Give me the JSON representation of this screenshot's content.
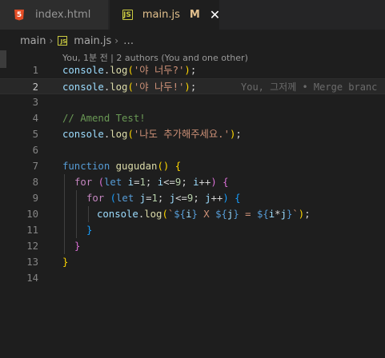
{
  "tabs": [
    {
      "label": "index.html",
      "icon": "html5-icon",
      "icon_text": "5"
    },
    {
      "label": "main.js",
      "icon": "js-file-icon",
      "icon_text": "JS",
      "badge": "M",
      "close": "✕"
    }
  ],
  "breadcrumb": {
    "folder": "main",
    "file": "main.js",
    "symbol": "…",
    "chevron": "›",
    "icon_text": "JS"
  },
  "blame_header": "You, 1분 전 | 2 authors (You and one other)",
  "ghost_blame": "You, 그저께 • Merge branc",
  "line_numbers": [
    "1",
    "2",
    "3",
    "4",
    "5",
    "6",
    "7",
    "8",
    "9",
    "10",
    "11",
    "12",
    "13",
    "14"
  ],
  "code": {
    "l1": [
      "console",
      ".",
      "log",
      "(",
      "'야 너두?'",
      ")",
      ";"
    ],
    "l2": [
      "console",
      ".",
      "log",
      "(",
      "'야 나두!'",
      ")",
      ";"
    ],
    "l4": "// Amend Test!",
    "l5": [
      "console",
      ".",
      "log",
      "(",
      "'나도 추가해주세요.'",
      ")",
      ";"
    ],
    "l7": [
      "function",
      " ",
      "gugudan",
      "(",
      ")",
      " ",
      "{"
    ],
    "l8": [
      "for",
      " ",
      "(",
      "let",
      " ",
      "i",
      "=",
      "1",
      "; ",
      "i",
      "<=",
      "9",
      "; ",
      "i",
      "++",
      ") ",
      "{"
    ],
    "l9": [
      "for",
      " ",
      "(",
      "let",
      " ",
      "j",
      "=",
      "1",
      "; ",
      "j",
      "<=",
      "9",
      "; ",
      "j",
      "++",
      ") ",
      "{"
    ],
    "l10": [
      "console",
      ".",
      "log",
      "(",
      "`",
      "${",
      "i",
      "}",
      " X ",
      "${",
      "j",
      "}",
      " = ",
      "${",
      "i",
      "*",
      "j",
      "}",
      "`",
      ")",
      ";"
    ],
    "l11": "}",
    "l12": "}",
    "l13": "}"
  }
}
